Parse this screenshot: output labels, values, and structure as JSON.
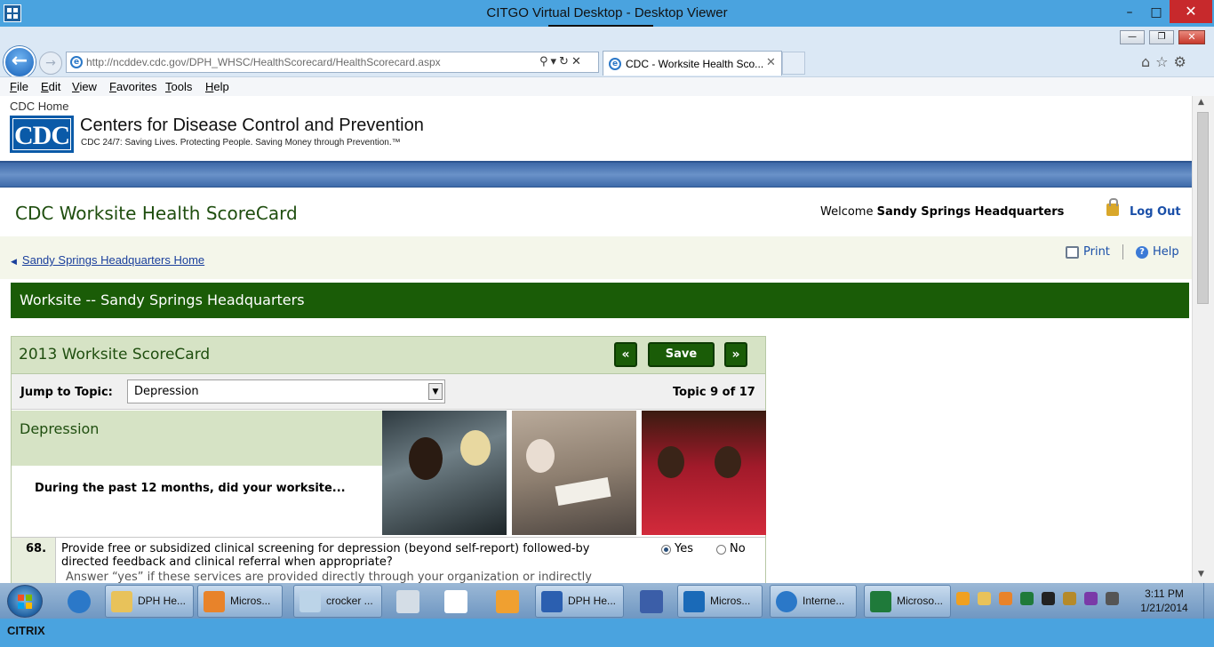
{
  "citrix": {
    "title": "CITGO Virtual Desktop - Desktop Viewer",
    "toolbar_glyph": "⠿⠿⠿ ⬇ ⠿⠿⠿",
    "minimize": "–",
    "restore": "□",
    "close": "✕",
    "brand": "CITRIX"
  },
  "browser": {
    "url": "http://ncddev.cdc.gov/DPH_WHSC/HealthScorecard/HealthScorecard.aspx",
    "address_tools": "⚲▾↻✕",
    "tab_title": "CDC - Worksite Health Sco...",
    "tab_close": "✕",
    "back": "←",
    "forward": "→",
    "right_icons": "⌂☆⚙",
    "win_min": "—",
    "win_restore": "❐",
    "win_close": "✕",
    "menu": [
      "File",
      "Edit",
      "View",
      "Favorites",
      "Tools",
      "Help"
    ]
  },
  "cdc": {
    "home_link": "CDC Home",
    "logo_text": "CDC",
    "org_name": "Centers for Disease Control and Prevention",
    "tagline": "CDC 24/7: Saving Lives. Protecting People. Saving Money through Prevention.™"
  },
  "app": {
    "title": "CDC Worksite Health ScoreCard",
    "welcome_prefix": "Welcome ",
    "welcome_name": "Sandy Springs Headquarters",
    "logout": "Log Out",
    "home_link": "Sandy Springs Headquarters Home",
    "print": "Print",
    "help": "Help",
    "help_glyph": "?",
    "worksite_bar": "Worksite -- Sandy Springs Headquarters"
  },
  "scorecard": {
    "title": "2013 Worksite ScoreCard",
    "prev": "«",
    "save": "Save",
    "next": "»",
    "jump_label": "Jump to Topic:",
    "selected_topic": "Depression",
    "caret": "▼",
    "topic_count": "Topic 9 of 17",
    "topic_name": "Depression",
    "question_intro": "During the past 12 months, did your worksite...",
    "question": {
      "number": "68.",
      "text": "Provide free or subsidized clinical screening for depression (beyond self-report) followed-by directed feedback and clinical referral when appropriate?",
      "hint": "Answer “yes” if these services are provided directly through your organization or indirectly",
      "yes": "Yes",
      "no": "No",
      "selected": "Yes"
    }
  },
  "scrollbar": {
    "up": "▲",
    "down": "▼"
  },
  "taskbar": {
    "items": [
      "DPH He...",
      "Micros...",
      "crocker ...",
      "DPH He...",
      "Micros...",
      "Interne...",
      "Microso..."
    ],
    "time": "3:11 PM",
    "date": "1/21/2014",
    "colors": {
      "ie": "#2b78c8",
      "folder": "#e8c25a",
      "outlook": "#e8832a",
      "word": "#2b5fb0",
      "excel": "#1f7a3a",
      "lync": "#1a6ab8"
    }
  }
}
